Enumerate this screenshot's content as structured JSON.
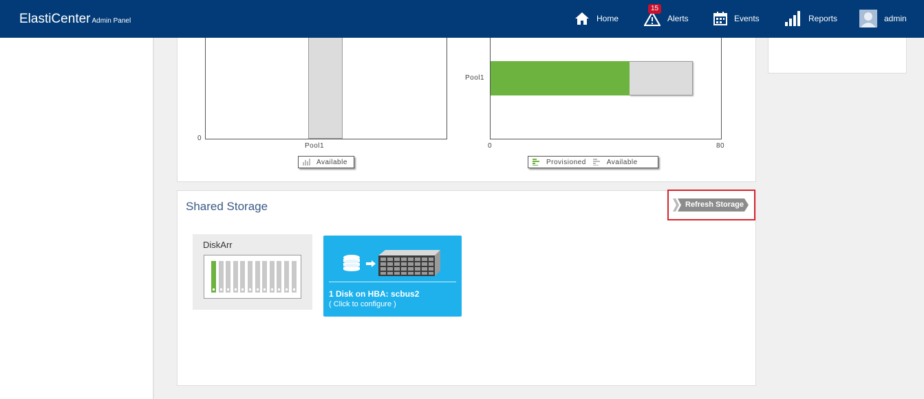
{
  "header": {
    "brand": "ElastiCenter",
    "brand_sub": "Admin Panel",
    "nav": {
      "home": "Home",
      "alerts": "Alerts",
      "alerts_badge": "15",
      "events": "Events",
      "reports": "Reports",
      "user": "admin"
    }
  },
  "chart_data": [
    {
      "type": "bar",
      "categories": [
        "Pool1"
      ],
      "series": [
        {
          "name": "Available",
          "values": [
            null
          ]
        }
      ],
      "yticks": [
        "0"
      ],
      "legend": [
        "Available"
      ],
      "legend_placement": "bottom"
    },
    {
      "type": "bar",
      "orientation": "horizontal",
      "categories": [
        "Pool1"
      ],
      "series": [
        {
          "name": "Provisioned",
          "values": [
            48
          ]
        },
        {
          "name": "Available",
          "values": [
            22
          ]
        }
      ],
      "xlim": [
        0,
        80
      ],
      "xticks": [
        "0",
        "80"
      ],
      "stacked": true,
      "colors": {
        "Provisioned": "#6db33f",
        "Available": "#dcdcdc"
      },
      "legend_placement": "bottom"
    }
  ],
  "storage": {
    "title": "Shared Storage",
    "refresh_label": "Refresh Storage",
    "diskarr_title": "DiskArr",
    "slots_total": 12,
    "slots_used": 1,
    "hba_title": "1 Disk on HBA: scbus2",
    "hba_hint": "( Click to configure )"
  },
  "colors": {
    "header": "#023b78",
    "accent_green": "#6db33f",
    "card_blue": "#1fb1ec",
    "highlight_red": "#d9232d"
  }
}
